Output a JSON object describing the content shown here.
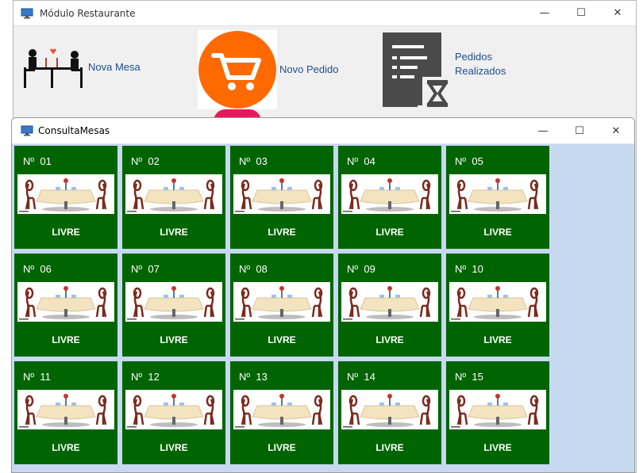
{
  "background_window": {
    "title": "Módulo Restaurante",
    "controls": {
      "minimize": "—",
      "maximize": "☐",
      "close": "✕"
    },
    "shortcuts": [
      {
        "label": "Nova Mesa",
        "icon": "dining-couple-icon"
      },
      {
        "label": "Novo Pedido",
        "icon": "shopping-cart-icon"
      },
      {
        "label_line1": "Pedidos",
        "label_line2": "Realizados",
        "icon": "order-list-hourglass-icon"
      }
    ]
  },
  "front_window": {
    "title": "ConsultaMesas",
    "controls": {
      "minimize": "—",
      "maximize": "☐",
      "close": "✕"
    }
  },
  "mesas": [
    {
      "numero": "Nº  01",
      "status": "LIVRE"
    },
    {
      "numero": "Nº  02",
      "status": "LIVRE"
    },
    {
      "numero": "Nº  03",
      "status": "LIVRE"
    },
    {
      "numero": "Nº  04",
      "status": "LIVRE"
    },
    {
      "numero": "Nº  05",
      "status": "LIVRE"
    },
    {
      "numero": "Nº  06",
      "status": "LIVRE"
    },
    {
      "numero": "Nº  07",
      "status": "LIVRE"
    },
    {
      "numero": "Nº  08",
      "status": "LIVRE"
    },
    {
      "numero": "Nº  09",
      "status": "LIVRE"
    },
    {
      "numero": "Nº  10",
      "status": "LIVRE"
    },
    {
      "numero": "Nº  11",
      "status": "LIVRE"
    },
    {
      "numero": "Nº  12",
      "status": "LIVRE"
    },
    {
      "numero": "Nº  13",
      "status": "LIVRE"
    },
    {
      "numero": "Nº  14",
      "status": "LIVRE"
    },
    {
      "numero": "Nº  15",
      "status": "LIVRE"
    }
  ],
  "colors": {
    "mesa_livre": "#006400",
    "window_body": "#c6d9f1",
    "cart_orange": "#ff6a00",
    "link_blue": "#1f4e8c"
  }
}
